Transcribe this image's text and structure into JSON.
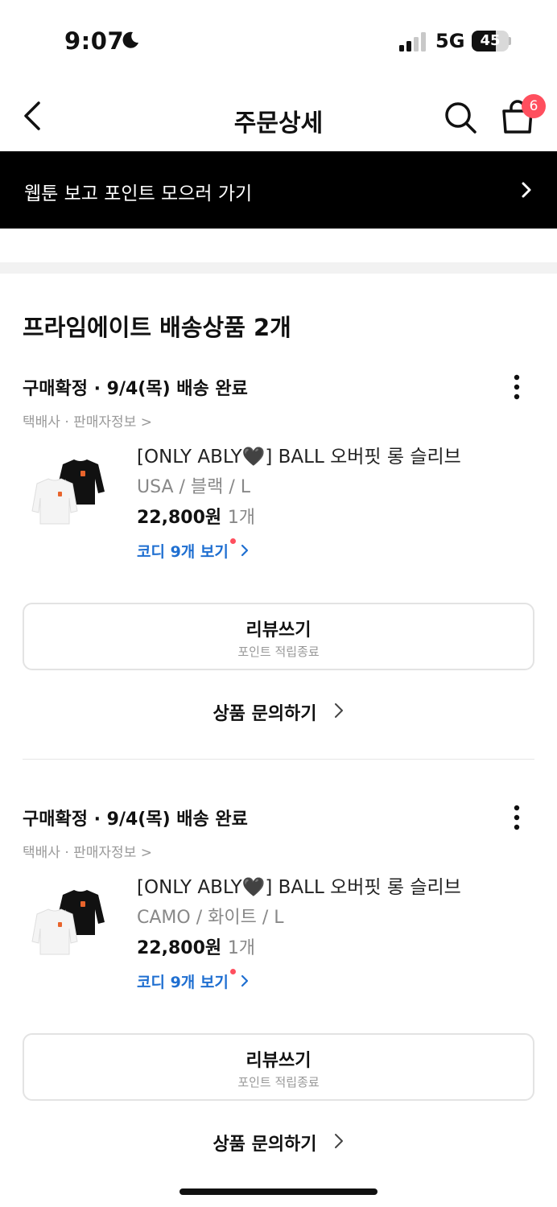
{
  "status_bar": {
    "time": "9:07",
    "network": "5G",
    "battery": "45"
  },
  "header": {
    "title": "주문상세",
    "cart_count": "6"
  },
  "banner": {
    "text": "웹툰 보고 포인트 모으러 가기"
  },
  "section": {
    "title": "프라임에이트 배송상품 2개"
  },
  "orders": [
    {
      "status": "구매확정 · 9/4(목) 배송 완료",
      "seller_link": "택배사 · 판매자정보 >",
      "product_name": "[ONLY ABLY🖤] BALL 오버핏 롱 슬리브",
      "option": "USA / 블랙 / L",
      "price": "22,800원",
      "quantity": "1개",
      "codi_link": "코디 9개 보기",
      "review_label": "리뷰쓰기",
      "review_sub": "포인트 적립종료",
      "inquiry_label": "상품 문의하기"
    },
    {
      "status": "구매확정 · 9/4(목) 배송 완료",
      "seller_link": "택배사 · 판매자정보 >",
      "product_name": "[ONLY ABLY🖤] BALL 오버핏 롱 슬리브",
      "option": "CAMO / 화이트 / L",
      "price": "22,800원",
      "quantity": "1개",
      "codi_link": "코디 9개 보기",
      "review_label": "리뷰쓰기",
      "review_sub": "포인트 적립종료",
      "inquiry_label": "상품 문의하기"
    }
  ]
}
